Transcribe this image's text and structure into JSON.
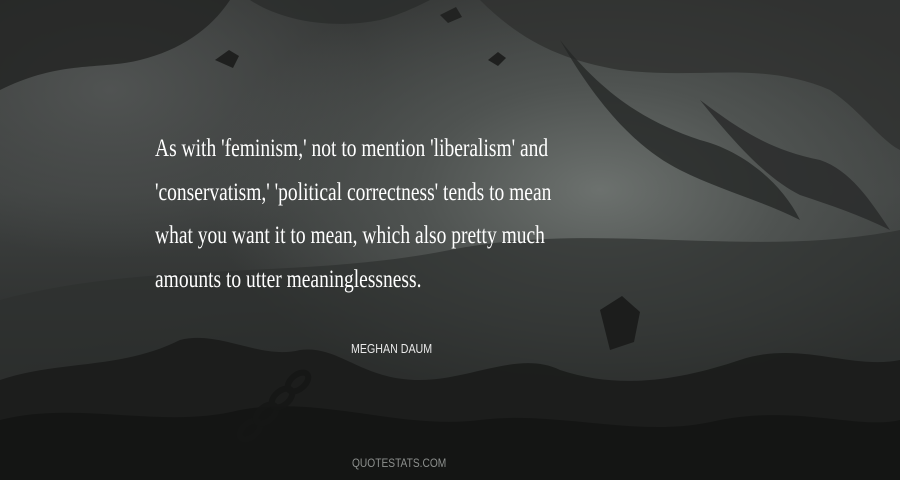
{
  "quote": {
    "lines": [
      "As with 'feminism,' not to mention 'liberalism' and",
      "'conservatism,' 'political correctness' tends to mean",
      "what you want it to mean, which also pretty much",
      "amounts to utter meaninglessness."
    ]
  },
  "author": "MEGHAN DAUM",
  "watermark": "QUOTESTATS.COM",
  "colors": {
    "text": "#ffffff",
    "watermark": "#8d908e",
    "background": "#3e4140"
  },
  "background_image": "dark fantasy landscape"
}
